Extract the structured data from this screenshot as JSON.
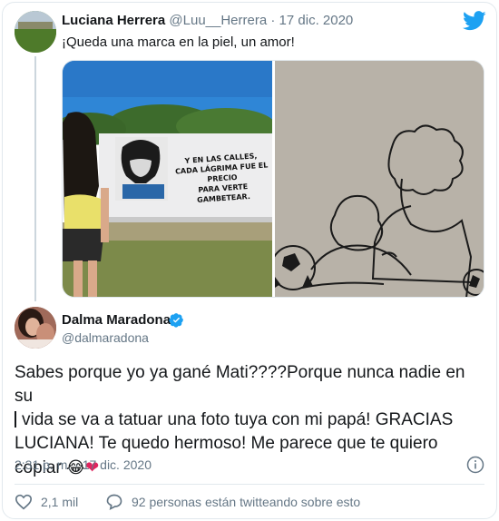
{
  "quoted": {
    "name": "Luciana Herrera",
    "handle": "@Luu__Herrera",
    "separator": "·",
    "date": "17 dic. 2020",
    "text": "¡Queda una marca en la piel, un amor!",
    "mural_text_1": "Y EN LAS CALLES,",
    "mural_text_2": "CADA LÁGRIMA FUE EL PRECIO",
    "mural_text_3": "PARA VERTE GAMBETEAR."
  },
  "tweet": {
    "name": "Dalma Maradona",
    "handle": "@dalmaradona",
    "line1": "Sabes porque yo ya gané Mati????Porque nunca nadie en su",
    "line2": "vida se va a tatuar una foto tuya con mi papá! GRACIAS",
    "line3": "LUCIANA! Te quedo hermoso! Me parece que te quiero",
    "line4": "copiar",
    "emoji": "😂",
    "heart": "❤",
    "timestamp": "2:31 p. m. · 17 dic. 2020",
    "likes": "2,1 mil",
    "talking": "92 personas están twitteando sobre esto"
  },
  "colors": {
    "accent": "#1da1f2",
    "muted": "#657786",
    "heart": "#e0245e"
  },
  "icons": [
    "twitter-bird-icon",
    "verified-badge-icon",
    "info-icon",
    "heart-icon",
    "reply-bubble-icon"
  ]
}
